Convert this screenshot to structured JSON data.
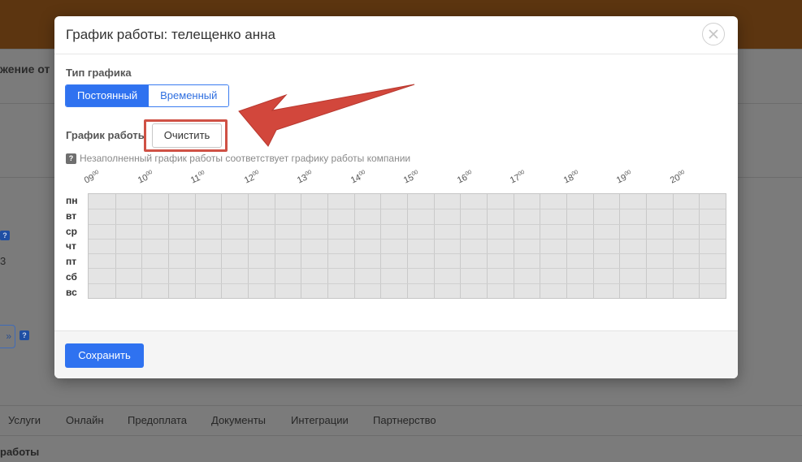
{
  "background": {
    "title": "жение от",
    "value": "3",
    "field_text": "»",
    "tabs": [
      "Услуги",
      "Онлайн",
      "Предоплата",
      "Документы",
      "Интеграции",
      "Партнерство"
    ],
    "bottom_text": "работы"
  },
  "modal": {
    "title": "График работы: телещенко анна",
    "schedule_type_label": "Тип графика",
    "schedule_types": [
      {
        "label": "Постоянный",
        "active": true
      },
      {
        "label": "Временный",
        "active": false
      }
    ],
    "work_schedule_label": "График работы",
    "clear_button": "Очистить",
    "hint_icon": "?",
    "hint": "Незаполненный график работы соответствует графику работы компании",
    "hours": [
      "09",
      "10",
      "11",
      "12",
      "13",
      "14",
      "15",
      "16",
      "17",
      "18",
      "19",
      "20"
    ],
    "hour_suffix": "00",
    "days": [
      "пн",
      "вт",
      "ср",
      "чт",
      "пт",
      "сб",
      "вс"
    ],
    "save_button": "Сохранить"
  },
  "icons": {
    "close": "close-icon",
    "help": "question-icon",
    "annotation_arrow": "red-arrow-icon"
  },
  "colors": {
    "accent": "#2f72f0",
    "highlight": "#cf5145",
    "grid_cell": "#e4e4e4",
    "header_bg": "#5c3510"
  }
}
